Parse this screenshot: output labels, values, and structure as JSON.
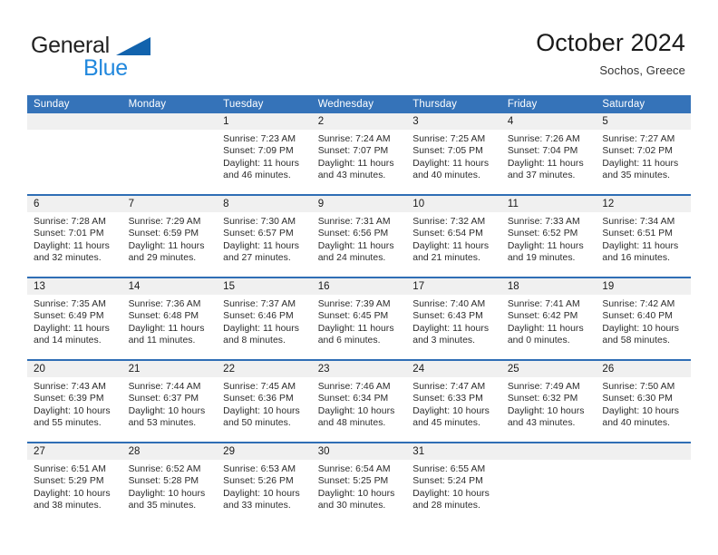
{
  "brand": {
    "name_part1": "General",
    "name_part2": "Blue",
    "triangle_icon": "triangle-icon"
  },
  "header": {
    "title": "October 2024",
    "subtitle": "Sochos, Greece"
  },
  "colors": {
    "header_blue": "#3573b9",
    "row_border_blue": "#2f6eb5",
    "daynum_band": "#f0f0f0",
    "brand_blue": "#2288dd",
    "brand_triangle": "#1263ad"
  },
  "weekday_headers": [
    "Sunday",
    "Monday",
    "Tuesday",
    "Wednesday",
    "Thursday",
    "Friday",
    "Saturday"
  ],
  "weeks": [
    [
      {
        "day": "",
        "sunrise": "",
        "sunset": "",
        "daylight_line1": "",
        "daylight_line2": "",
        "empty": true
      },
      {
        "day": "",
        "sunrise": "",
        "sunset": "",
        "daylight_line1": "",
        "daylight_line2": "",
        "empty": true
      },
      {
        "day": "1",
        "sunrise": "Sunrise: 7:23 AM",
        "sunset": "Sunset: 7:09 PM",
        "daylight_line1": "Daylight: 11 hours",
        "daylight_line2": "and 46 minutes."
      },
      {
        "day": "2",
        "sunrise": "Sunrise: 7:24 AM",
        "sunset": "Sunset: 7:07 PM",
        "daylight_line1": "Daylight: 11 hours",
        "daylight_line2": "and 43 minutes."
      },
      {
        "day": "3",
        "sunrise": "Sunrise: 7:25 AM",
        "sunset": "Sunset: 7:05 PM",
        "daylight_line1": "Daylight: 11 hours",
        "daylight_line2": "and 40 minutes."
      },
      {
        "day": "4",
        "sunrise": "Sunrise: 7:26 AM",
        "sunset": "Sunset: 7:04 PM",
        "daylight_line1": "Daylight: 11 hours",
        "daylight_line2": "and 37 minutes."
      },
      {
        "day": "5",
        "sunrise": "Sunrise: 7:27 AM",
        "sunset": "Sunset: 7:02 PM",
        "daylight_line1": "Daylight: 11 hours",
        "daylight_line2": "and 35 minutes."
      }
    ],
    [
      {
        "day": "6",
        "sunrise": "Sunrise: 7:28 AM",
        "sunset": "Sunset: 7:01 PM",
        "daylight_line1": "Daylight: 11 hours",
        "daylight_line2": "and 32 minutes."
      },
      {
        "day": "7",
        "sunrise": "Sunrise: 7:29 AM",
        "sunset": "Sunset: 6:59 PM",
        "daylight_line1": "Daylight: 11 hours",
        "daylight_line2": "and 29 minutes."
      },
      {
        "day": "8",
        "sunrise": "Sunrise: 7:30 AM",
        "sunset": "Sunset: 6:57 PM",
        "daylight_line1": "Daylight: 11 hours",
        "daylight_line2": "and 27 minutes."
      },
      {
        "day": "9",
        "sunrise": "Sunrise: 7:31 AM",
        "sunset": "Sunset: 6:56 PM",
        "daylight_line1": "Daylight: 11 hours",
        "daylight_line2": "and 24 minutes."
      },
      {
        "day": "10",
        "sunrise": "Sunrise: 7:32 AM",
        "sunset": "Sunset: 6:54 PM",
        "daylight_line1": "Daylight: 11 hours",
        "daylight_line2": "and 21 minutes."
      },
      {
        "day": "11",
        "sunrise": "Sunrise: 7:33 AM",
        "sunset": "Sunset: 6:52 PM",
        "daylight_line1": "Daylight: 11 hours",
        "daylight_line2": "and 19 minutes."
      },
      {
        "day": "12",
        "sunrise": "Sunrise: 7:34 AM",
        "sunset": "Sunset: 6:51 PM",
        "daylight_line1": "Daylight: 11 hours",
        "daylight_line2": "and 16 minutes."
      }
    ],
    [
      {
        "day": "13",
        "sunrise": "Sunrise: 7:35 AM",
        "sunset": "Sunset: 6:49 PM",
        "daylight_line1": "Daylight: 11 hours",
        "daylight_line2": "and 14 minutes."
      },
      {
        "day": "14",
        "sunrise": "Sunrise: 7:36 AM",
        "sunset": "Sunset: 6:48 PM",
        "daylight_line1": "Daylight: 11 hours",
        "daylight_line2": "and 11 minutes."
      },
      {
        "day": "15",
        "sunrise": "Sunrise: 7:37 AM",
        "sunset": "Sunset: 6:46 PM",
        "daylight_line1": "Daylight: 11 hours",
        "daylight_line2": "and 8 minutes."
      },
      {
        "day": "16",
        "sunrise": "Sunrise: 7:39 AM",
        "sunset": "Sunset: 6:45 PM",
        "daylight_line1": "Daylight: 11 hours",
        "daylight_line2": "and 6 minutes."
      },
      {
        "day": "17",
        "sunrise": "Sunrise: 7:40 AM",
        "sunset": "Sunset: 6:43 PM",
        "daylight_line1": "Daylight: 11 hours",
        "daylight_line2": "and 3 minutes."
      },
      {
        "day": "18",
        "sunrise": "Sunrise: 7:41 AM",
        "sunset": "Sunset: 6:42 PM",
        "daylight_line1": "Daylight: 11 hours",
        "daylight_line2": "and 0 minutes."
      },
      {
        "day": "19",
        "sunrise": "Sunrise: 7:42 AM",
        "sunset": "Sunset: 6:40 PM",
        "daylight_line1": "Daylight: 10 hours",
        "daylight_line2": "and 58 minutes."
      }
    ],
    [
      {
        "day": "20",
        "sunrise": "Sunrise: 7:43 AM",
        "sunset": "Sunset: 6:39 PM",
        "daylight_line1": "Daylight: 10 hours",
        "daylight_line2": "and 55 minutes."
      },
      {
        "day": "21",
        "sunrise": "Sunrise: 7:44 AM",
        "sunset": "Sunset: 6:37 PM",
        "daylight_line1": "Daylight: 10 hours",
        "daylight_line2": "and 53 minutes."
      },
      {
        "day": "22",
        "sunrise": "Sunrise: 7:45 AM",
        "sunset": "Sunset: 6:36 PM",
        "daylight_line1": "Daylight: 10 hours",
        "daylight_line2": "and 50 minutes."
      },
      {
        "day": "23",
        "sunrise": "Sunrise: 7:46 AM",
        "sunset": "Sunset: 6:34 PM",
        "daylight_line1": "Daylight: 10 hours",
        "daylight_line2": "and 48 minutes."
      },
      {
        "day": "24",
        "sunrise": "Sunrise: 7:47 AM",
        "sunset": "Sunset: 6:33 PM",
        "daylight_line1": "Daylight: 10 hours",
        "daylight_line2": "and 45 minutes."
      },
      {
        "day": "25",
        "sunrise": "Sunrise: 7:49 AM",
        "sunset": "Sunset: 6:32 PM",
        "daylight_line1": "Daylight: 10 hours",
        "daylight_line2": "and 43 minutes."
      },
      {
        "day": "26",
        "sunrise": "Sunrise: 7:50 AM",
        "sunset": "Sunset: 6:30 PM",
        "daylight_line1": "Daylight: 10 hours",
        "daylight_line2": "and 40 minutes."
      }
    ],
    [
      {
        "day": "27",
        "sunrise": "Sunrise: 6:51 AM",
        "sunset": "Sunset: 5:29 PM",
        "daylight_line1": "Daylight: 10 hours",
        "daylight_line2": "and 38 minutes."
      },
      {
        "day": "28",
        "sunrise": "Sunrise: 6:52 AM",
        "sunset": "Sunset: 5:28 PM",
        "daylight_line1": "Daylight: 10 hours",
        "daylight_line2": "and 35 minutes."
      },
      {
        "day": "29",
        "sunrise": "Sunrise: 6:53 AM",
        "sunset": "Sunset: 5:26 PM",
        "daylight_line1": "Daylight: 10 hours",
        "daylight_line2": "and 33 minutes."
      },
      {
        "day": "30",
        "sunrise": "Sunrise: 6:54 AM",
        "sunset": "Sunset: 5:25 PM",
        "daylight_line1": "Daylight: 10 hours",
        "daylight_line2": "and 30 minutes."
      },
      {
        "day": "31",
        "sunrise": "Sunrise: 6:55 AM",
        "sunset": "Sunset: 5:24 PM",
        "daylight_line1": "Daylight: 10 hours",
        "daylight_line2": "and 28 minutes."
      },
      {
        "day": "",
        "sunrise": "",
        "sunset": "",
        "daylight_line1": "",
        "daylight_line2": "",
        "empty": true
      },
      {
        "day": "",
        "sunrise": "",
        "sunset": "",
        "daylight_line1": "",
        "daylight_line2": "",
        "empty": true
      }
    ]
  ]
}
